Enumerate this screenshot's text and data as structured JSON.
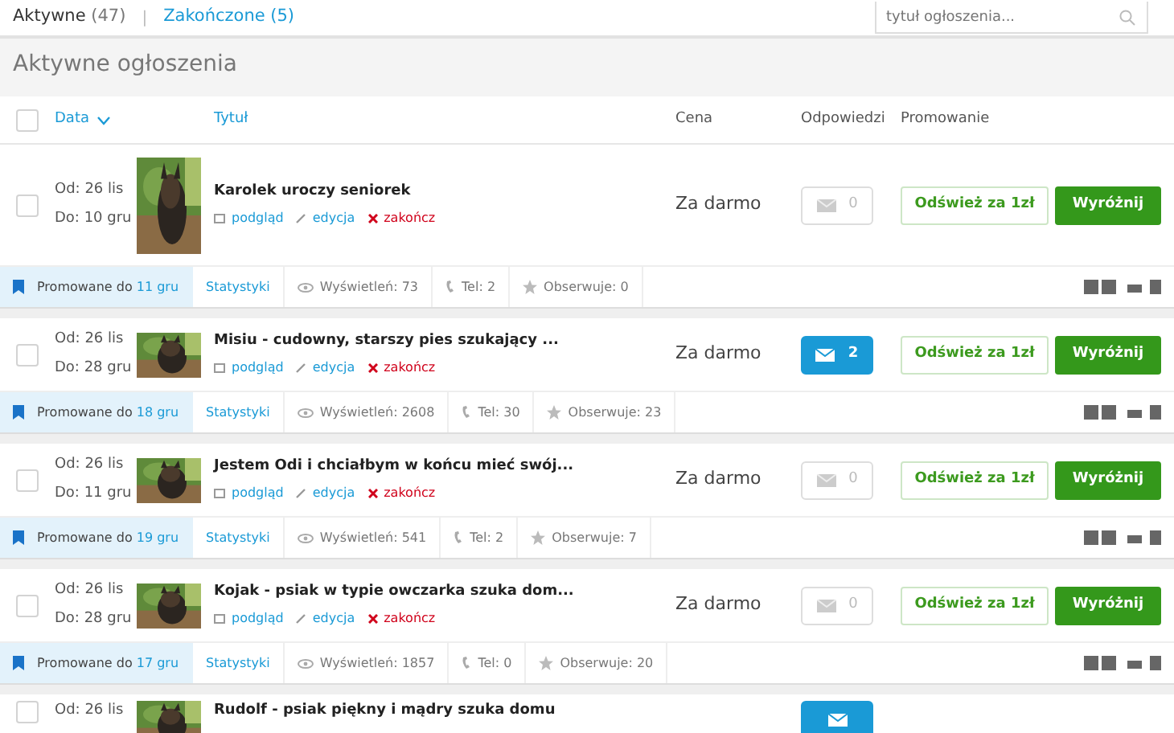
{
  "tabs": [
    {
      "label": "Aktywne",
      "count": "(47)",
      "selected": true
    },
    {
      "label": "Zakończone",
      "count": "(5)",
      "selected": false
    }
  ],
  "tab_separator": "|",
  "search": {
    "placeholder": "tytuł ogłoszenia..."
  },
  "section_title": "Aktywne ogłoszenia",
  "select_all": {
    "checked": false
  },
  "columns": {
    "date": "Data",
    "title": "Tytuł",
    "price": "Cena",
    "replies": "Odpowiedzi",
    "promotion": "Promowanie"
  },
  "listings": [
    {
      "checked": false,
      "from": "Od: 26 lis",
      "to": "Do: 10 gru",
      "title": "Karolek uroczy seniorek",
      "links": {
        "preview": "podgląd",
        "edit": "edycja",
        "end": "zakończ"
      },
      "price": "Za darmo",
      "replies": {
        "count": "0",
        "unread": false
      },
      "refresh": "Odśwież za 1zł",
      "feature": "Wyróżnij",
      "stats": {
        "promo_prefix": "Promowane do",
        "promo_date": "11 gru",
        "stats_link": "Statystyki",
        "views": "Wyświetleń: 73",
        "phone": "Tel: 2",
        "watchers": "Obserwuje: 0"
      }
    },
    {
      "checked": false,
      "from": "Od: 26 lis",
      "to": "Do: 28 gru",
      "title": "Misiu - cudowny, starszy pies szukający ...",
      "links": {
        "preview": "podgląd",
        "edit": "edycja",
        "end": "zakończ"
      },
      "price": "Za darmo",
      "replies": {
        "count": "2",
        "unread": true
      },
      "refresh": "Odśwież za 1zł",
      "feature": "Wyróżnij",
      "stats": {
        "promo_prefix": "Promowane do",
        "promo_date": "18 gru",
        "stats_link": "Statystyki",
        "views": "Wyświetleń: 2608",
        "phone": "Tel: 30",
        "watchers": "Obserwuje: 23"
      }
    },
    {
      "checked": false,
      "from": "Od: 26 lis",
      "to": "Do: 11 gru",
      "title": "Jestem Odi i chciałbym w końcu mieć swój...",
      "links": {
        "preview": "podgląd",
        "edit": "edycja",
        "end": "zakończ"
      },
      "price": "Za darmo",
      "replies": {
        "count": "0",
        "unread": false
      },
      "refresh": "Odśwież za 1zł",
      "feature": "Wyróżnij",
      "stats": {
        "promo_prefix": "Promowane do",
        "promo_date": "19 gru",
        "stats_link": "Statystyki",
        "views": "Wyświetleń: 541",
        "phone": "Tel: 2",
        "watchers": "Obserwuje: 7"
      }
    },
    {
      "checked": false,
      "from": "Od: 26 lis",
      "to": "Do: 28 gru",
      "title": "Kojak - psiak w typie owczarka szuka dom...",
      "links": {
        "preview": "podgląd",
        "edit": "edycja",
        "end": "zakończ"
      },
      "price": "Za darmo",
      "replies": {
        "count": "0",
        "unread": false
      },
      "refresh": "Odśwież za 1zł",
      "feature": "Wyróżnij",
      "stats": {
        "promo_prefix": "Promowane do",
        "promo_date": "17 gru",
        "stats_link": "Statystyki",
        "views": "Wyświetleń: 1857",
        "phone": "Tel: 0",
        "watchers": "Obserwuje: 20"
      }
    },
    {
      "checked": false,
      "from": "Od: 26 lis",
      "title": "Rudolf - psiak piękny i mądry szuka domu",
      "replies": {
        "unread": true
      }
    }
  ]
}
